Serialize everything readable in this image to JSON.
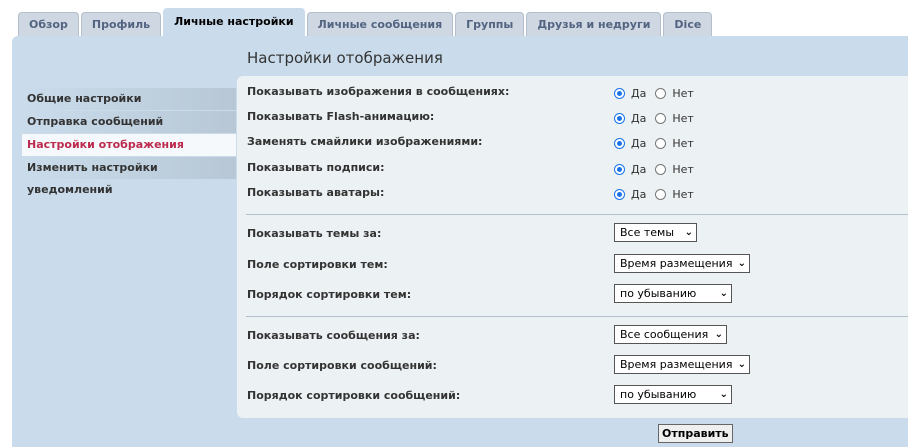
{
  "tabs": [
    "Обзор",
    "Профиль",
    "Личные настройки",
    "Личные сообщения",
    "Группы",
    "Друзья и недруги",
    "Dice"
  ],
  "main_title": "Настройки отображения",
  "sidebar": [
    "Общие настройки",
    "Отправка сообщений",
    "Настройки отображения",
    "Изменить настройки уведомлений"
  ],
  "radio_rows": [
    {
      "label": "Показывать изображения в сообщениях:",
      "yes": "Да",
      "no": "Нет",
      "selected": "Да"
    },
    {
      "label": "Показывать Flash-анимацию:",
      "yes": "Да",
      "no": "Нет",
      "selected": "Да"
    },
    {
      "label": "Заменять смайлики изображениями:",
      "yes": "Да",
      "no": "Нет",
      "selected": "Да"
    },
    {
      "label": "Показывать подписи:",
      "yes": "Да",
      "no": "Нет",
      "selected": "Да"
    },
    {
      "label": "Показывать аватары:",
      "yes": "Да",
      "no": "Нет",
      "selected": "Да"
    }
  ],
  "topic_rows": [
    {
      "label": "Показывать темы за:",
      "value": "Все темы"
    },
    {
      "label": "Поле сортировки тем:",
      "value": "Время размещения"
    },
    {
      "label": "Порядок сортировки тем:",
      "value": "по убыванию"
    }
  ],
  "post_rows": [
    {
      "label": "Показывать сообщения за:",
      "value": "Все сообщения"
    },
    {
      "label": "Поле сортировки сообщений:",
      "value": "Время размещения"
    },
    {
      "label": "Порядок сортировки сообщений:",
      "value": "по убыванию"
    }
  ],
  "submit_label": "Отправить",
  "icons": {
    "select_arrow": "chevron-down-icon"
  },
  "colors": {
    "panel": "#cadceb",
    "content": "#ecf1f3",
    "active_menu_text": "#bc2a4d",
    "radio_accent": "#1a73e8"
  }
}
